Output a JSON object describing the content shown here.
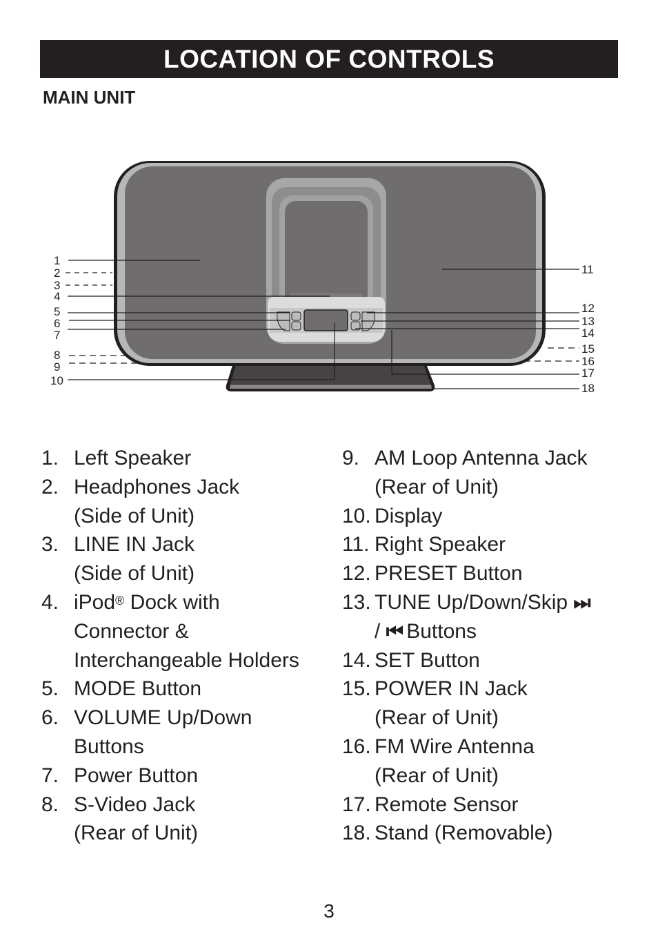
{
  "header": {
    "title": "LOCATION OF CONTROLS"
  },
  "section": {
    "heading": "MAIN UNIT"
  },
  "diagram": {
    "callouts": [
      "1",
      "2",
      "3",
      "4",
      "5",
      "6",
      "7",
      "8",
      "9",
      "10",
      "11",
      "12",
      "13",
      "14",
      "15",
      "16",
      "17",
      "18"
    ]
  },
  "controls_left": [
    {
      "num": "1.",
      "lines": [
        "Left Speaker"
      ]
    },
    {
      "num": "2.",
      "lines": [
        "Headphones Jack",
        "(Side of Unit)"
      ]
    },
    {
      "num": "3.",
      "lines": [
        "LINE IN Jack",
        "(Side of Unit)"
      ]
    },
    {
      "num": "4.",
      "lines": [
        "iPod",
        "Dock with",
        "Connector &",
        "Interchangeable Holders"
      ],
      "sup": "®"
    },
    {
      "num": "5.",
      "lines": [
        "MODE Button"
      ]
    },
    {
      "num": "6.",
      "lines": [
        "VOLUME Up/Down",
        "Buttons"
      ]
    },
    {
      "num": "7.",
      "lines": [
        "Power Button"
      ]
    },
    {
      "num": "8.",
      "lines": [
        "S-Video Jack",
        "(Rear of Unit)"
      ]
    }
  ],
  "controls_right": [
    {
      "num": "9.",
      "lines": [
        "AM Loop Antenna Jack",
        "(Rear of Unit)"
      ]
    },
    {
      "num": "10.",
      "lines": [
        "Display"
      ]
    },
    {
      "num": "11.",
      "lines": [
        "Right Speaker"
      ]
    },
    {
      "num": "12.",
      "lines": [
        "PRESET Button"
      ]
    },
    {
      "num": "13.",
      "lines": [
        "TUNE Up/Down/Skip",
        "/",
        "Buttons"
      ],
      "icons": [
        "skip-next-icon",
        "skip-previous-icon"
      ],
      "icon_glyphs": [
        "⏭",
        "⏮"
      ]
    },
    {
      "num": "14.",
      "lines": [
        "SET Button"
      ]
    },
    {
      "num": "15.",
      "lines": [
        "POWER IN Jack",
        "(Rear of Unit)"
      ]
    },
    {
      "num": "16.",
      "lines": [
        "FM Wire Antenna",
        "(Rear of Unit)"
      ]
    },
    {
      "num": "17.",
      "lines": [
        "Remote Sensor"
      ]
    },
    {
      "num": "18.",
      "lines": [
        "Stand (Removable)"
      ]
    }
  ],
  "footer": {
    "page_number": "3"
  }
}
